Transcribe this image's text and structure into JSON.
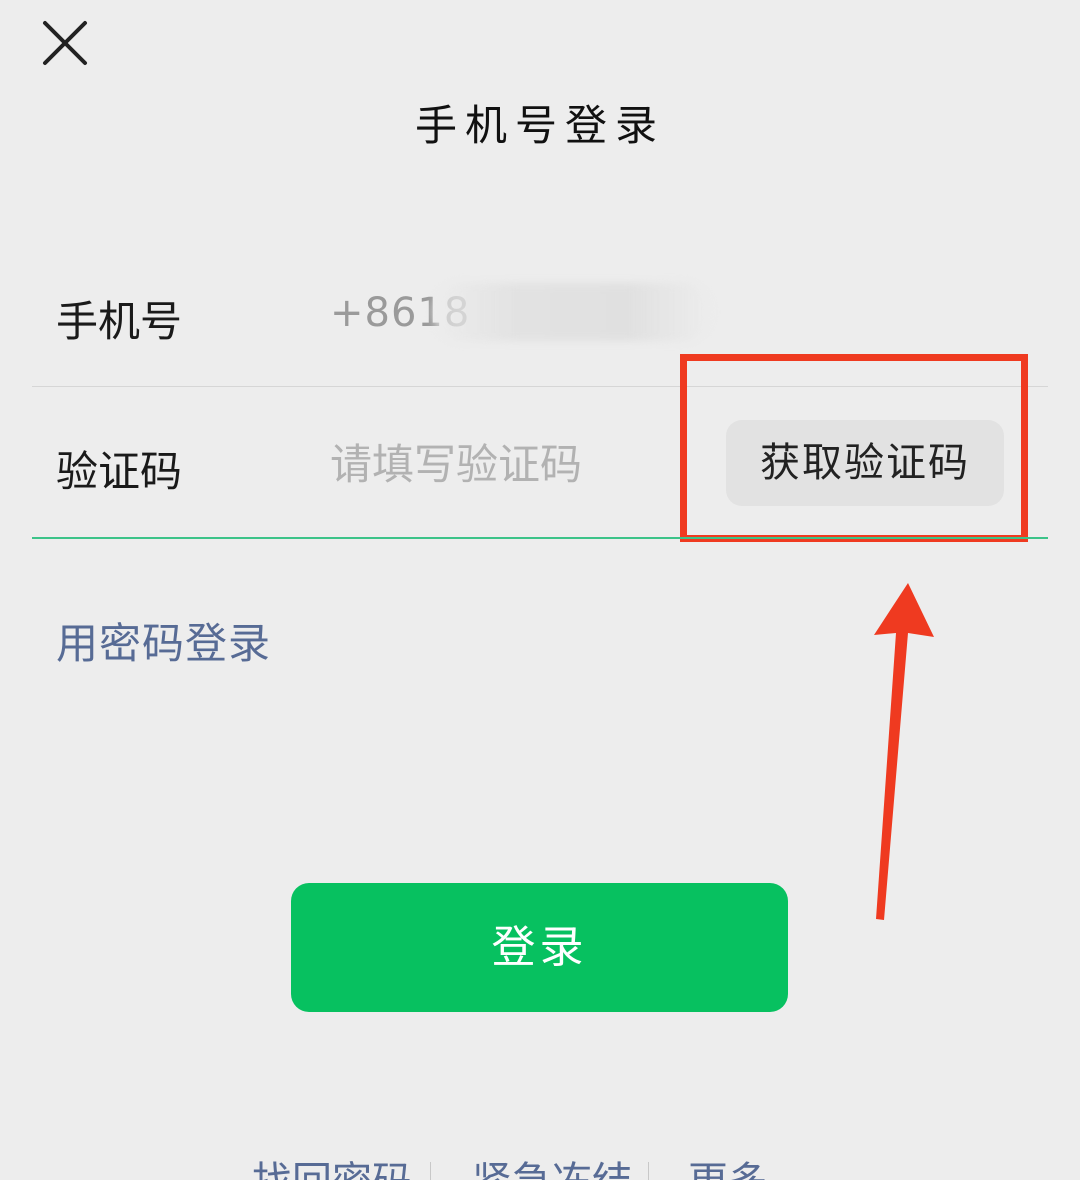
{
  "header": {
    "close_icon": "close-icon",
    "title": "手机号登录"
  },
  "form": {
    "phone_label": "手机号",
    "phone_value": "+8618",
    "code_label": "验证码",
    "code_placeholder": "请填写验证码",
    "get_code_label": "获取验证码"
  },
  "password_login_link": "用密码登录",
  "login_button": "登录",
  "annotation": {
    "highlight_color": "#ef3a20",
    "arrow_icon": "arrow-up-icon"
  },
  "colors": {
    "primary_green": "#07c160",
    "link_blue": "#576b95",
    "focus_line": "#3cc389"
  },
  "footer": {
    "items": [
      "找回密码",
      "紧急冻结",
      "更多"
    ]
  }
}
